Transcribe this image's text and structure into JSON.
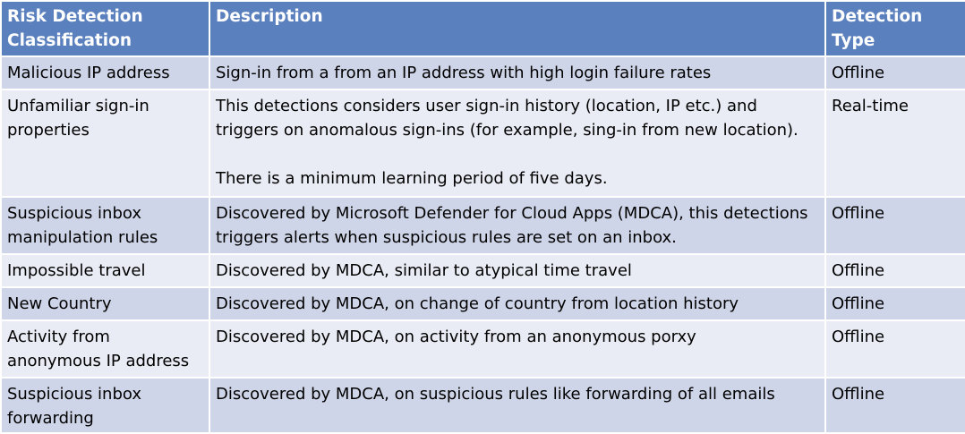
{
  "table": {
    "headers": [
      "Risk Detection Classification",
      "Description",
      "Detection Type"
    ],
    "rows": [
      {
        "classification": "Malicious IP address",
        "description": [
          "Sign-in from a from an IP address with high login failure rates"
        ],
        "type": "Offline"
      },
      {
        "classification": "Unfamiliar sign-in properties",
        "description": [
          "This detections considers user sign-in history (location, IP etc.) and triggers on anomalous sign-ins (for example, sing-in from new location).",
          "There is a minimum learning period of five days."
        ],
        "type": "Real-time"
      },
      {
        "classification": "Suspicious inbox manipulation rules",
        "description": [
          "Discovered by Microsoft Defender for Cloud Apps (MDCA), this detections triggers alerts when suspicious rules are set on an inbox."
        ],
        "type": "Offline"
      },
      {
        "classification": "Impossible travel",
        "description": [
          "Discovered by MDCA, similar to atypical time travel"
        ],
        "type": "Offline"
      },
      {
        "classification": "New Country",
        "description": [
          "Discovered by MDCA, on change of country from location history"
        ],
        "type": "Offline"
      },
      {
        "classification": "Activity from anonymous IP address",
        "description": [
          "Discovered by MDCA, on activity from an anonymous porxy"
        ],
        "type": "Offline"
      },
      {
        "classification": "Suspicious inbox forwarding",
        "description": [
          "Discovered by MDCA, on suspicious rules like forwarding of all emails"
        ],
        "type": "Offline"
      }
    ]
  }
}
